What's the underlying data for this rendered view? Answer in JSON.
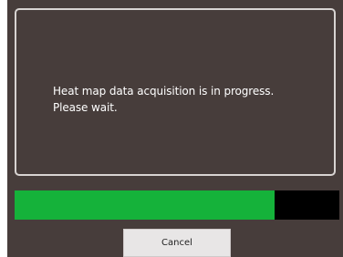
{
  "dialog": {
    "message_line1": "Heat map data acquisition is in progress.",
    "message_line2": "Please wait.",
    "progress_fraction": 0.8,
    "progress_color": "#15b23a",
    "track_color": "#000000",
    "cancel_label": "Cancel"
  }
}
